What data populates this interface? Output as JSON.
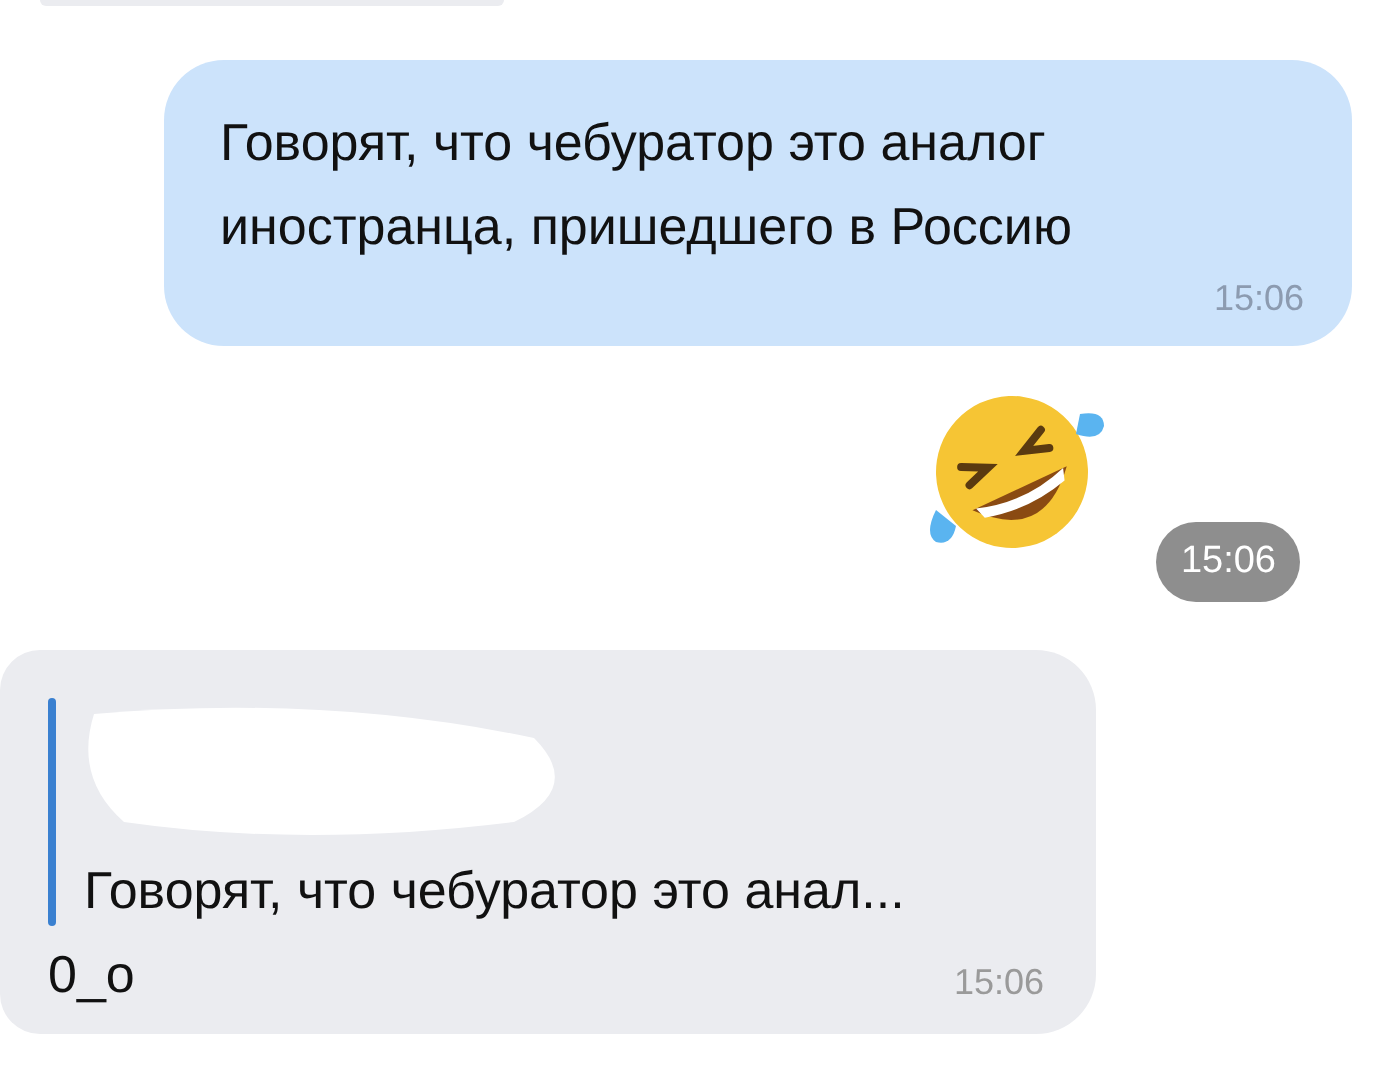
{
  "messages": [
    {
      "kind": "cut_off"
    },
    {
      "kind": "outgoing_text",
      "text": "Говорят, что чебуратор это аналог иностранца, пришедшего в Россию",
      "time": "15:06"
    },
    {
      "kind": "outgoing_sticker",
      "time": "15:06"
    },
    {
      "kind": "incoming_reply",
      "quote": "Говорят, что чебуратор это анал...",
      "text": "0_о",
      "time": "15:06"
    }
  ]
}
